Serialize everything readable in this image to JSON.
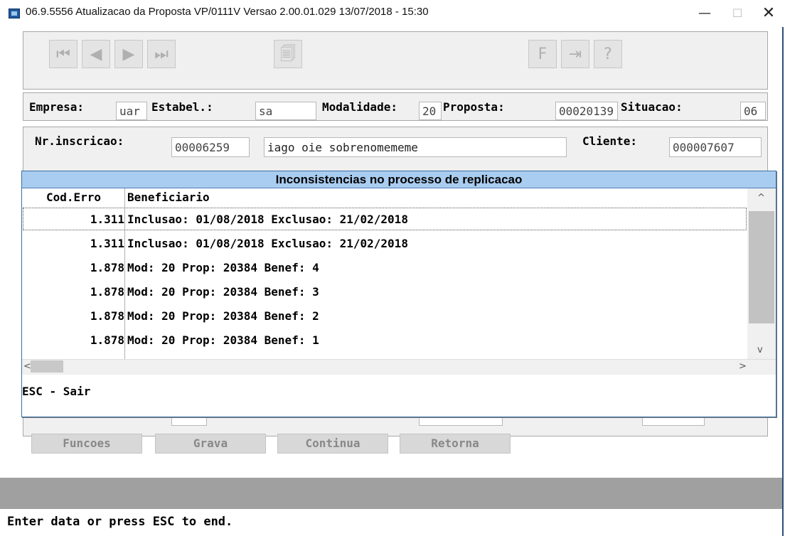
{
  "window": {
    "title": "06.9.5556 Atualizacao da Proposta VP/0111V Versao 2.00.01.029 13/07/2018 - 15:30",
    "min_glyph": "—",
    "max_glyph": "☐",
    "close_glyph": "✕"
  },
  "toolbar": {
    "first_glyph": "⏮",
    "prev_glyph": "◀",
    "next_glyph": "▶",
    "last_glyph": "⏭",
    "copy_glyph": "🗐",
    "f_glyph": "F",
    "exit_glyph": "⇥",
    "help_glyph": "?"
  },
  "header_form": {
    "empresa_label": "Empresa:",
    "empresa_value": "uar",
    "estabel_label": "Estabel.:",
    "estabel_value": "sa",
    "modalidade_label": "Modalidade:",
    "modalidade_value": "20",
    "proposta_label": "Proposta:",
    "proposta_value": "00020139",
    "situacao_label": "Situacao:",
    "situacao_value": "06"
  },
  "detail_form": {
    "nr_inscricao_label": "Nr.inscricao:",
    "nr_inscricao_value": "00006259",
    "nome_value": "iago oie sobrenomememe",
    "cliente_label": "Cliente:",
    "cliente_value": "000007607"
  },
  "dialog": {
    "title": "Inconsistencias no processo de replicacao",
    "columns": [
      "Cod.Erro",
      "Beneficiario"
    ],
    "rows": [
      {
        "code": "1.311",
        "text": "Inclusao: 01/08/2018 Exclusao: 21/02/2018"
      },
      {
        "code": "1.311",
        "text": "Inclusao: 01/08/2018 Exclusao: 21/02/2018"
      },
      {
        "code": "1.878",
        "text": "Mod: 20 Prop: 20384 Benef: 4"
      },
      {
        "code": "1.878",
        "text": "Mod: 20 Prop: 20384 Benef: 3"
      },
      {
        "code": "1.878",
        "text": "Mod: 20 Prop: 20384 Benef: 2"
      },
      {
        "code": "1.878",
        "text": "Mod: 20 Prop: 20384 Benef: 1"
      }
    ],
    "scroll_up": "^",
    "scroll_down": "v",
    "scroll_left": "<",
    "scroll_right": ">",
    "esc_hint": "ESC - Sair"
  },
  "actions": {
    "funcoes": "Funcoes",
    "grava": "Grava",
    "continua": "Continua",
    "retorna": "Retorna"
  },
  "status_bar": {
    "message": "Enter data or press ESC to end."
  }
}
